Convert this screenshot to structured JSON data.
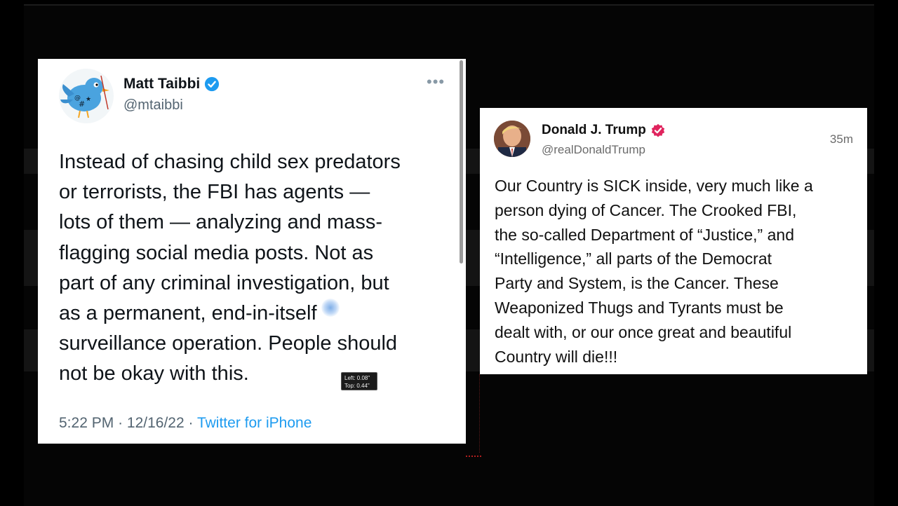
{
  "tweet": {
    "name": "Matt Taibbi",
    "handle": "@mtaibbi",
    "more_icon": "more-horizontal-icon",
    "body_lines": [
      "Instead of chasing child sex predators",
      "or terrorists, the FBI has agents —",
      "lots of them — analyzing and mass-",
      "flagging social media posts. Not as",
      "part of any criminal investigation, but",
      "as a permanent, end-in-itself",
      "surveillance operation. People should",
      "not be okay with this."
    ],
    "time": "5:22 PM",
    "date": "12/16/22",
    "separator": "·",
    "source": "Twitter for iPhone",
    "verified_color": "#1d9bf0"
  },
  "tooltip": {
    "left": "Left: 0.08\"",
    "top": "Top: 0.44\""
  },
  "post": {
    "name": "Donald J. Trump",
    "handle": "@realDonaldTrump",
    "time_ago": "35m",
    "body_lines": [
      "Our Country is SICK inside, very much like a",
      "person dying of Cancer. The Crooked FBI,",
      "the so-called Department of “Justice,” and",
      "“Intelligence,” all parts of the Democrat",
      "Party and System, is the Cancer. These",
      "Weaponized Thugs and Tyrants must be",
      "dealt with, or our once great and beautiful",
      "Country will die!!!"
    ],
    "verified_color": "#e0245e"
  }
}
